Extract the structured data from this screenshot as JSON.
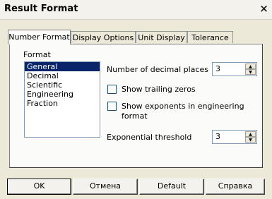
{
  "window": {
    "title": "Result Format",
    "close_symbol": "×"
  },
  "tabs": [
    {
      "label": "Number Format",
      "active": true
    },
    {
      "label": "Display Options",
      "active": false
    },
    {
      "label": "Unit Display",
      "active": false
    },
    {
      "label": "Tolerance",
      "active": false
    }
  ],
  "format": {
    "label": "Format",
    "items": [
      "General",
      "Decimal",
      "Scientific",
      "Engineering",
      "Fraction"
    ],
    "selected": "General"
  },
  "decimal_places": {
    "label": "Number of decimal places",
    "value": "3"
  },
  "show_trailing_zeros": {
    "label": "Show trailing zeros",
    "checked": false
  },
  "show_exponents": {
    "label_line1": "Show exponents in engineering",
    "label_line2": "format",
    "checked": false
  },
  "exp_threshold": {
    "label": "Exponential threshold",
    "value": "3"
  },
  "spin": {
    "up": "▲",
    "down": "▼"
  },
  "buttons": {
    "ok": "OK",
    "cancel": "Отмена",
    "default": "Default",
    "help": "Справка"
  },
  "colors": {
    "selection": "#0a246a",
    "dialog_bg": "#ece9d8"
  }
}
